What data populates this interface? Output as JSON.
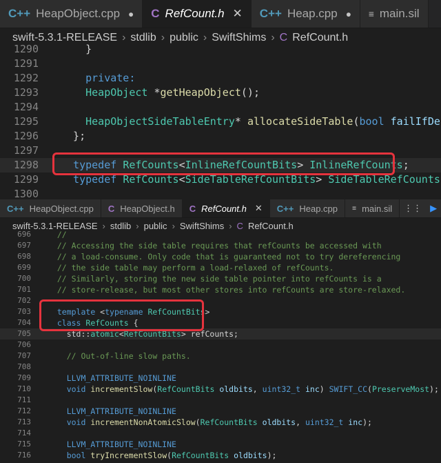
{
  "pane_top": {
    "tabs": [
      {
        "icon": "C++",
        "label": "HeapObject.cpp",
        "kind": "cpp",
        "state": "dot"
      },
      {
        "icon": "C",
        "label": "RefCount.h",
        "kind": "h",
        "state": "close",
        "active": true
      },
      {
        "icon": "C++",
        "label": "Heap.cpp",
        "kind": "cpp",
        "state": "dot"
      },
      {
        "icon": "≡",
        "label": "main.sil",
        "kind": "sil",
        "state": ""
      }
    ],
    "breadcrumb": [
      "swift-5.3.1-RELEASE",
      "stdlib",
      "public",
      "SwiftShims"
    ],
    "breadcrumb_file": {
      "icon": "C",
      "label": "RefCount.h"
    },
    "lines": [
      {
        "n": "1290",
        "segs": [
          [
            "    }",
            ""
          ]
        ]
      },
      {
        "n": "1291",
        "segs": []
      },
      {
        "n": "1292",
        "segs": [
          [
            "    ",
            ""
          ],
          [
            "private:",
            "kw"
          ]
        ]
      },
      {
        "n": "1293",
        "segs": [
          [
            "    ",
            ""
          ],
          [
            "HeapObject",
            "ty"
          ],
          [
            " *",
            ""
          ],
          [
            "getHeapObject",
            "fn"
          ],
          [
            "();",
            ""
          ]
        ]
      },
      {
        "n": "1294",
        "segs": []
      },
      {
        "n": "1295",
        "segs": [
          [
            "    ",
            ""
          ],
          [
            "HeapObjectSideTableEntry",
            "ty"
          ],
          [
            "* ",
            ""
          ],
          [
            "allocateSideTable",
            "fn"
          ],
          [
            "(",
            ""
          ],
          [
            "bool",
            "kw"
          ],
          [
            " ",
            ""
          ],
          [
            "failIfDeiniting",
            "pm"
          ],
          [
            ");",
            ""
          ]
        ]
      },
      {
        "n": "1296",
        "segs": [
          [
            "  };",
            ""
          ]
        ]
      },
      {
        "n": "1297",
        "segs": []
      },
      {
        "n": "1298",
        "segs": [
          [
            "  ",
            ""
          ],
          [
            "typedef",
            "kw"
          ],
          [
            " ",
            ""
          ],
          [
            "RefCounts",
            "ty"
          ],
          [
            "<",
            ""
          ],
          [
            "InlineRefCountBits",
            "ty"
          ],
          [
            "> ",
            ""
          ],
          [
            "InlineRefCounts",
            "ty"
          ],
          [
            ";",
            ""
          ]
        ]
      },
      {
        "n": "1299",
        "segs": [
          [
            "  ",
            ""
          ],
          [
            "typedef",
            "kw"
          ],
          [
            " ",
            ""
          ],
          [
            "RefCounts",
            "ty"
          ],
          [
            "<",
            ""
          ],
          [
            "SideTableRefCountBits",
            "ty"
          ],
          [
            "> ",
            ""
          ],
          [
            "SideTableRefCounts",
            "ty"
          ],
          [
            ";",
            ""
          ]
        ]
      },
      {
        "n": "1300",
        "segs": []
      }
    ]
  },
  "pane_bottom": {
    "tabs": [
      {
        "icon": "C++",
        "label": "HeapObject.cpp",
        "kind": "cpp",
        "state": ""
      },
      {
        "icon": "C",
        "label": "HeapObject.h",
        "kind": "h",
        "state": ""
      },
      {
        "icon": "C",
        "label": "RefCount.h",
        "kind": "h",
        "state": "close",
        "active": true
      },
      {
        "icon": "C++",
        "label": "Heap.cpp",
        "kind": "cpp",
        "state": ""
      },
      {
        "icon": "≡",
        "label": "main.sil",
        "kind": "sil",
        "state": ""
      }
    ],
    "breadcrumb": [
      "swift-5.3.1-RELEASE",
      "stdlib",
      "public",
      "SwiftShims"
    ],
    "breadcrumb_file": {
      "icon": "C",
      "label": "RefCount.h"
    },
    "lines": [
      {
        "n": "696",
        "segs": [
          [
            "  //",
            "cm"
          ]
        ]
      },
      {
        "n": "697",
        "segs": [
          [
            "  // Accessing the side table requires that refCounts be accessed with",
            "cm"
          ]
        ]
      },
      {
        "n": "698",
        "segs": [
          [
            "  // a load-consume. Only code that is guaranteed not to try dereferencing",
            "cm"
          ]
        ]
      },
      {
        "n": "699",
        "segs": [
          [
            "  // the side table may perform a load-relaxed of refCounts.",
            "cm"
          ]
        ]
      },
      {
        "n": "700",
        "segs": [
          [
            "  // Similarly, storing the new side table pointer into refCounts is a",
            "cm"
          ]
        ]
      },
      {
        "n": "701",
        "segs": [
          [
            "  // store-release, but most other stores into refCounts are store-relaxed.",
            "cm"
          ]
        ]
      },
      {
        "n": "702",
        "segs": []
      },
      {
        "n": "703",
        "segs": [
          [
            "  ",
            ""
          ],
          [
            "template",
            "kw"
          ],
          [
            " <",
            ""
          ],
          [
            "typename",
            "kw"
          ],
          [
            " ",
            ""
          ],
          [
            "RefCountBits",
            "ty"
          ],
          [
            ">",
            ""
          ]
        ]
      },
      {
        "n": "704",
        "segs": [
          [
            "  ",
            ""
          ],
          [
            "class",
            "kw"
          ],
          [
            " ",
            ""
          ],
          [
            "RefCounts",
            "ty"
          ],
          [
            " {",
            ""
          ]
        ]
      },
      {
        "n": "705",
        "segs": [
          [
            "    std::",
            ""
          ],
          [
            "atomic",
            "ty"
          ],
          [
            "<",
            ""
          ],
          [
            "RefCountBits",
            "ty"
          ],
          [
            "> refCounts;",
            ""
          ]
        ]
      },
      {
        "n": "706",
        "segs": []
      },
      {
        "n": "707",
        "segs": [
          [
            "    // Out-of-line slow paths.",
            "cm"
          ]
        ]
      },
      {
        "n": "708",
        "segs": []
      },
      {
        "n": "709",
        "segs": [
          [
            "    ",
            ""
          ],
          [
            "LLVM_ATTRIBUTE_NOINLINE",
            "kw"
          ]
        ]
      },
      {
        "n": "710",
        "segs": [
          [
            "    ",
            ""
          ],
          [
            "void",
            "kw"
          ],
          [
            " ",
            ""
          ],
          [
            "incrementSlow",
            "fn"
          ],
          [
            "(",
            ""
          ],
          [
            "RefCountBits",
            "ty"
          ],
          [
            " ",
            ""
          ],
          [
            "oldbits",
            "pm"
          ],
          [
            ", ",
            ""
          ],
          [
            "uint32_t",
            "kw"
          ],
          [
            " ",
            ""
          ],
          [
            "inc",
            "pm"
          ],
          [
            ") ",
            ""
          ],
          [
            "SWIFT_CC",
            "kw"
          ],
          [
            "(",
            ""
          ],
          [
            "PreserveMost",
            "mc"
          ],
          [
            ");",
            ""
          ]
        ]
      },
      {
        "n": "711",
        "segs": []
      },
      {
        "n": "712",
        "segs": [
          [
            "    ",
            ""
          ],
          [
            "LLVM_ATTRIBUTE_NOINLINE",
            "kw"
          ]
        ]
      },
      {
        "n": "713",
        "segs": [
          [
            "    ",
            ""
          ],
          [
            "void",
            "kw"
          ],
          [
            " ",
            ""
          ],
          [
            "incrementNonAtomicSlow",
            "fn"
          ],
          [
            "(",
            ""
          ],
          [
            "RefCountBits",
            "ty"
          ],
          [
            " ",
            ""
          ],
          [
            "oldbits",
            "pm"
          ],
          [
            ", ",
            ""
          ],
          [
            "uint32_t",
            "kw"
          ],
          [
            " ",
            ""
          ],
          [
            "inc",
            "pm"
          ],
          [
            ");",
            ""
          ]
        ]
      },
      {
        "n": "714",
        "segs": []
      },
      {
        "n": "715",
        "segs": [
          [
            "    ",
            ""
          ],
          [
            "LLVM_ATTRIBUTE_NOINLINE",
            "kw"
          ]
        ]
      },
      {
        "n": "716",
        "segs": [
          [
            "    ",
            ""
          ],
          [
            "bool",
            "kw"
          ],
          [
            " ",
            ""
          ],
          [
            "tryIncrementSlow",
            "fn"
          ],
          [
            "(",
            ""
          ],
          [
            "RefCountBits",
            "ty"
          ],
          [
            " ",
            ""
          ],
          [
            "oldbits",
            "pm"
          ],
          [
            ");",
            ""
          ]
        ]
      }
    ]
  },
  "tab_actions": [
    "⋮⋮",
    "▶"
  ],
  "colors": {
    "highlight": "#e5333d",
    "keyword": "#569cd6",
    "type": "#4ec9b0",
    "function": "#dcdcaa",
    "comment": "#6a9955"
  }
}
